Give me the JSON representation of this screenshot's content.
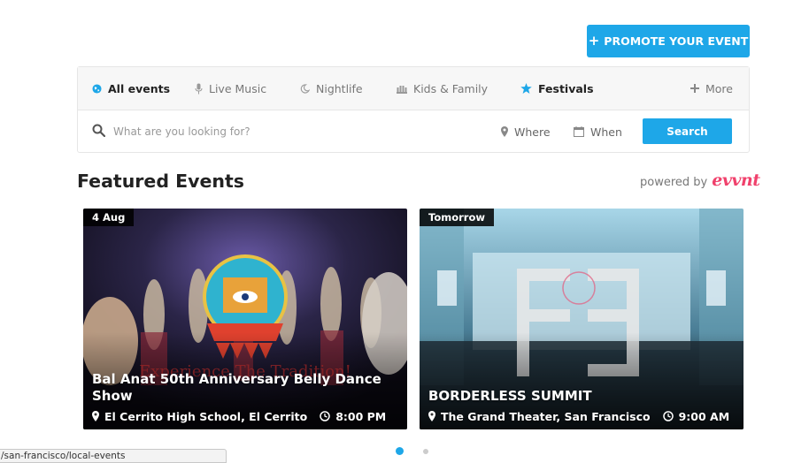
{
  "promote": {
    "label": "PROMOTE YOUR EVENT"
  },
  "tabs": [
    {
      "label": "All events",
      "icon": "globe-icon"
    },
    {
      "label": "Live Music",
      "icon": "microphone-icon"
    },
    {
      "label": "Nightlife",
      "icon": "moon-icon"
    },
    {
      "label": "Kids & Family",
      "icon": "family-icon"
    },
    {
      "label": "Festivals",
      "icon": "star-icon"
    },
    {
      "label": "More",
      "icon": "plus-icon"
    }
  ],
  "search": {
    "placeholder": "What are you looking for?",
    "where_label": "Where",
    "when_label": "When",
    "button_label": "Search"
  },
  "featured": {
    "title": "Featured Events",
    "powered_by": "powered by",
    "brand": "evvnt"
  },
  "events": [
    {
      "date": "4 Aug",
      "title": "Bal Anat 50th Anniversary Belly Dance Show",
      "location": "El Cerrito High School, El Cerrito",
      "time": "8:00 PM"
    },
    {
      "date": "Tomorrow",
      "title": "BORDERLESS SUMMIT",
      "location": "The Grand Theater, San Francisco",
      "time": "9:00 AM"
    }
  ],
  "status_bar": {
    "url": "/san-francisco/local-events"
  },
  "colors": {
    "accent": "#1ea7e8",
    "brand": "#f0416c"
  }
}
